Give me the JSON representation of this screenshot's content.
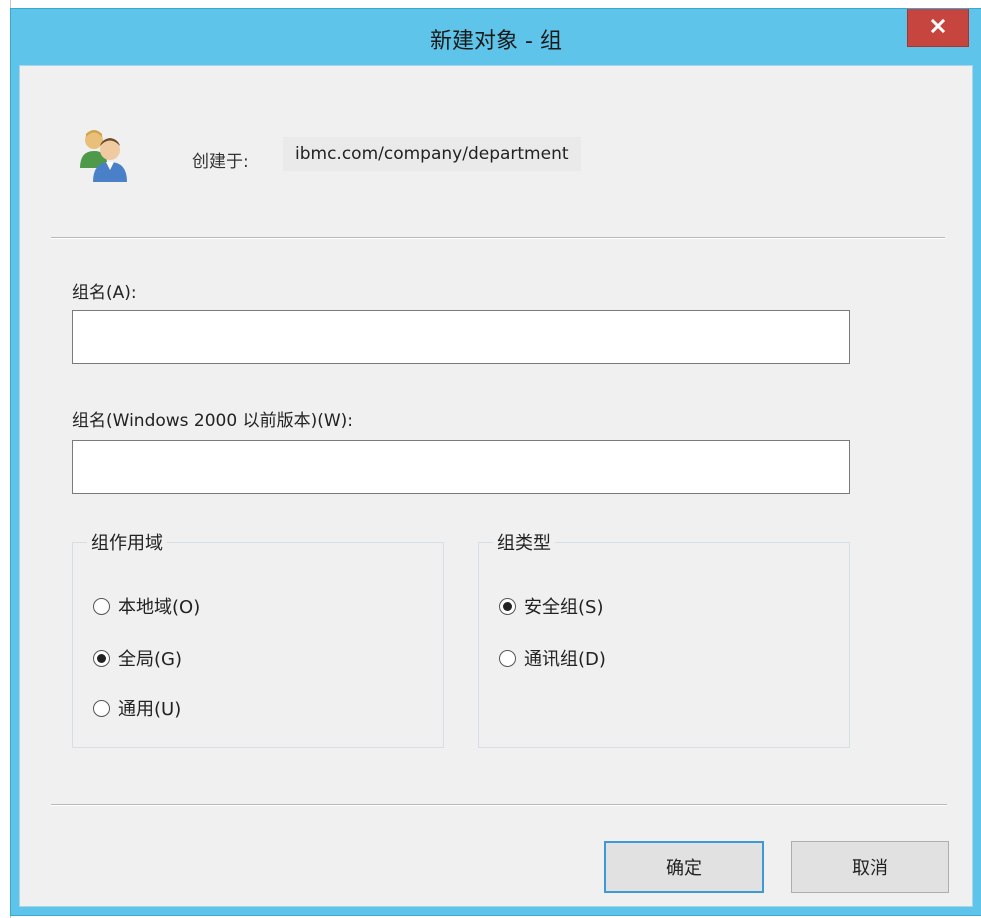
{
  "dialog": {
    "title": "新建对象 - 组",
    "close_label": "x"
  },
  "header": {
    "icon": "group-users-icon",
    "created_in_label": "创建于:",
    "created_in_value": "ibmc.com/company/department"
  },
  "fields": {
    "group_name_label": "组名(A):",
    "group_name_value": "",
    "group_name_pre2000_label": "组名(Windows 2000 以前版本)(W):",
    "group_name_pre2000_value": ""
  },
  "group_scope": {
    "title": "组作用域",
    "options": [
      {
        "label": "本地域(O)",
        "checked": false
      },
      {
        "label": "全局(G)",
        "checked": true
      },
      {
        "label": "通用(U)",
        "checked": false
      }
    ]
  },
  "group_type": {
    "title": "组类型",
    "options": [
      {
        "label": "安全组(S)",
        "checked": true
      },
      {
        "label": "通讯组(D)",
        "checked": false
      }
    ]
  },
  "buttons": {
    "ok_label": "确定",
    "cancel_label": "取消"
  },
  "colors": {
    "titlebar": "#5ec4ea",
    "close_button": "#c7453f",
    "dialog_background": "#f0f0f0",
    "default_button_border": "#3c9ad6"
  }
}
